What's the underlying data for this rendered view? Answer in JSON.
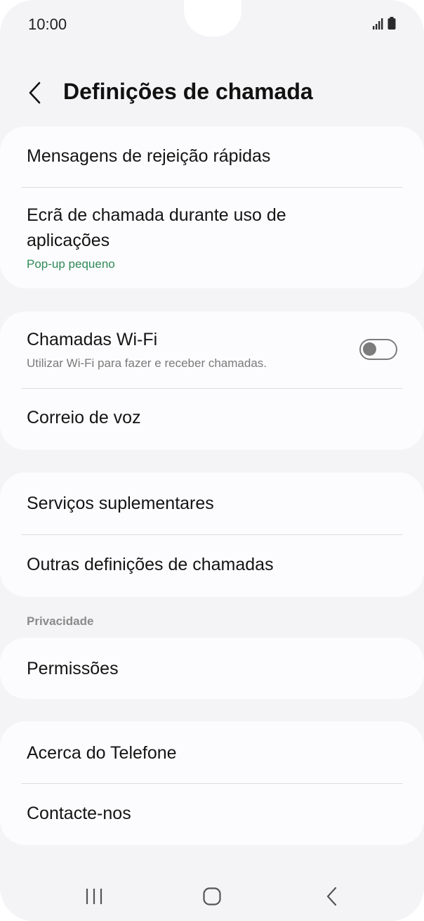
{
  "status_bar": {
    "time": "10:00",
    "icons": [
      "signal-icon",
      "battery-icon"
    ]
  },
  "header": {
    "title": "Definições de chamada",
    "back_icon": "chevron-left-icon"
  },
  "groups": {
    "g1": {
      "quick_decline": {
        "title": "Mensagens de rejeição rápidas"
      },
      "call_display": {
        "title_line1": "Ecrã de chamada durante uso de",
        "title_line2": "aplicações",
        "subtitle": "Pop-up pequeno"
      }
    },
    "g2": {
      "wifi_calling": {
        "title": "Chamadas Wi-Fi",
        "subtitle": "Utilizar Wi-Fi para fazer e receber chamadas.",
        "toggle_on": false
      },
      "voicemail": {
        "title": "Correio de voz"
      }
    },
    "g3": {
      "supplementary": {
        "title": "Serviços suplementares"
      },
      "other_settings": {
        "title": "Outras definições de chamadas"
      }
    },
    "privacy_header": "Privacidade",
    "g4": {
      "permissions": {
        "title": "Permissões"
      }
    },
    "g5": {
      "about": {
        "title": "Acerca do Telefone"
      },
      "contact": {
        "title": "Contacte-nos"
      }
    }
  },
  "nav_bar": {
    "icons": [
      "recents-icon",
      "home-icon",
      "back-icon"
    ]
  },
  "colors": {
    "accent_green": "#2e8a57",
    "background": "#f4f4f6",
    "card": "#fcfcfe"
  }
}
